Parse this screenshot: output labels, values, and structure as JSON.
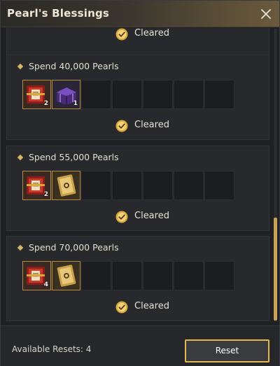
{
  "window": {
    "title": "Pearl's Blessings"
  },
  "top_partial": {
    "status": "Cleared"
  },
  "rewards": [
    {
      "title": "Spend 40,000 Pearls",
      "items": [
        {
          "icon": "red-scroll-chest-icon",
          "count": "2"
        },
        {
          "icon": "purple-treasure-chest-icon",
          "count": "1"
        }
      ],
      "status": "Cleared"
    },
    {
      "title": "Spend 55,000 Pearls",
      "items": [
        {
          "icon": "red-scroll-chest-icon",
          "count": "2"
        },
        {
          "icon": "gold-coupon-icon",
          "count": ""
        }
      ],
      "status": "Cleared"
    },
    {
      "title": "Spend 70,000 Pearls",
      "items": [
        {
          "icon": "red-scroll-chest-icon",
          "count": "4"
        },
        {
          "icon": "gold-coupon-icon",
          "count": ""
        }
      ],
      "status": "Cleared"
    }
  ],
  "footer": {
    "resets_label": "Available Resets: 4",
    "reset_button": "Reset"
  },
  "colors": {
    "accent_gold": "#e2b94c",
    "check_gold": "#d9a83a",
    "scroll_thumb": "#c9a155"
  }
}
